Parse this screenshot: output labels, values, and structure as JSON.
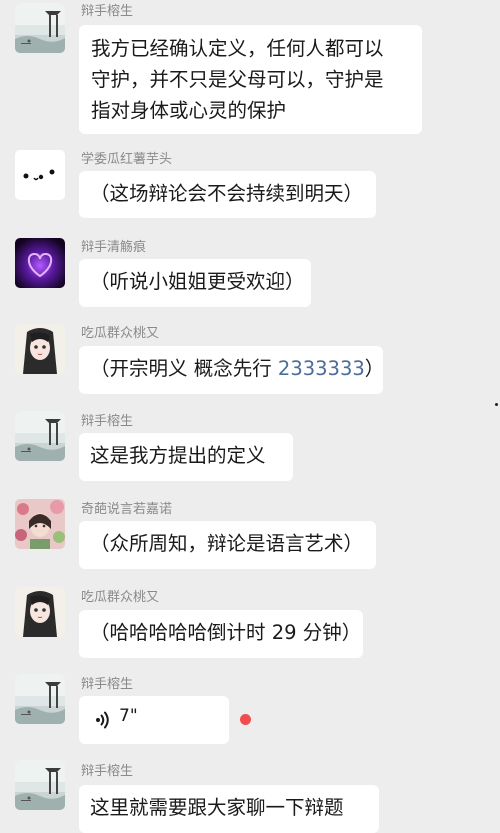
{
  "messages": [
    {
      "sender": "辩手榕生",
      "avatar": "landscape-pavilion-avatar",
      "lines": [
        "我方已经确认定义，任何人都可以",
        "守护，并不只是父母可以，守护是",
        "指对身体或心灵的保护"
      ]
    },
    {
      "sender": "学委瓜红薯芋头",
      "avatar": "dots-face-avatar",
      "text": "（这场辩论会不会持续到明天）"
    },
    {
      "sender": "辩手清觞痕",
      "avatar": "purple-heart-avatar",
      "text": "（听说小姐姐更受欢迎）"
    },
    {
      "sender": "吃瓜群众桃又",
      "avatar": "anime-girl-avatar",
      "text_before": "（开宗明义 概念先行 ",
      "text_number": "2333333",
      "text_after": "）"
    },
    {
      "sender": "辩手榕生",
      "avatar": "landscape-pavilion-avatar",
      "text": "这是我方提出的定义"
    },
    {
      "sender": "奇葩说言若嘉诺",
      "avatar": "flower-girl-avatar",
      "text": "（众所周知，辩论是语言艺术）"
    },
    {
      "sender": "吃瓜群众桃又",
      "avatar": "anime-girl-avatar",
      "text": "（哈哈哈哈哈倒计时 29 分钟）"
    },
    {
      "sender": "辩手榕生",
      "avatar": "landscape-pavilion-avatar",
      "voice_duration": "7\"",
      "unread": true
    },
    {
      "sender": "辩手榕生",
      "avatar": "landscape-pavilion-avatar",
      "text": "这里就需要跟大家聊一下辩题"
    }
  ],
  "colors": {
    "background": "#ededed",
    "bubble": "#ffffff",
    "sender_name": "#8a8a8a",
    "unread_dot": "#f24c4c",
    "link_number": "#4a6d9a"
  }
}
